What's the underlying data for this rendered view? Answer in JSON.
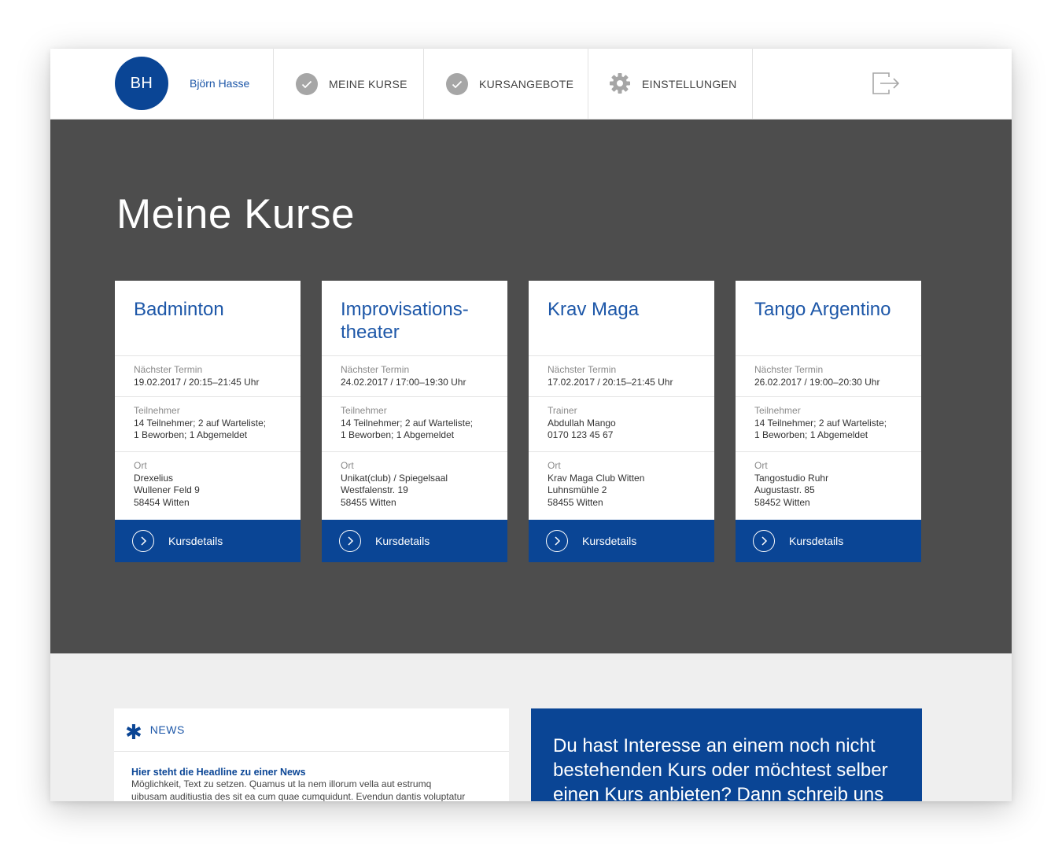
{
  "nav": {
    "user_initials": "BH",
    "user_name": "Björn Hasse",
    "items": [
      {
        "label": "MEINE KURSE",
        "icon": "check-circle-icon"
      },
      {
        "label": "KURSANGEBOTE",
        "icon": "check-circle-icon"
      },
      {
        "label": "EINSTELLUNGEN",
        "icon": "gear-icon"
      }
    ],
    "logout_icon": "logout-icon"
  },
  "hero": {
    "title": "Meine Kurse"
  },
  "cards": [
    {
      "title_line1": "Badminton",
      "title_line2": "",
      "s1_label": "Nächster Termin",
      "s1_lines": [
        "19.02.2017 / 20:15–21:45 Uhr"
      ],
      "s2_label": "Teilnehmer",
      "s2_lines": [
        "14 Teilnehmer; 2 auf Warteliste;",
        "1 Beworben; 1 Abgemeldet"
      ],
      "s3_label": "Ort",
      "s3_lines": [
        "Drexelius",
        "Wullener Feld 9",
        "58454 Witten"
      ],
      "button": "Kursdetails"
    },
    {
      "title_line1": "Improvisations-",
      "title_line2": "theater",
      "s1_label": "Nächster Termin",
      "s1_lines": [
        "24.02.2017 / 17:00–19:30 Uhr"
      ],
      "s2_label": "Teilnehmer",
      "s2_lines": [
        "14 Teilnehmer; 2 auf Warteliste;",
        "1 Beworben; 1 Abgemeldet"
      ],
      "s3_label": "Ort",
      "s3_lines": [
        "Unikat(club) / Spiegelsaal",
        "Westfalenstr. 19",
        "58455 Witten"
      ],
      "button": "Kursdetails"
    },
    {
      "title_line1": "Krav Maga",
      "title_line2": "",
      "s1_label": "Nächster Termin",
      "s1_lines": [
        "17.02.2017 / 20:15–21:45 Uhr"
      ],
      "s2_label": "Trainer",
      "s2_lines": [
        "Abdullah Mango",
        "0170 123 45 67"
      ],
      "s3_label": "Ort",
      "s3_lines": [
        "Krav Maga Club Witten",
        "Luhnsmühle 2",
        "58455 Witten"
      ],
      "button": "Kursdetails"
    },
    {
      "title_line1": "Tango Argentino",
      "title_line2": "",
      "s1_label": "Nächster Termin",
      "s1_lines": [
        "26.02.2017 / 19:00–20:30 Uhr"
      ],
      "s2_label": "Teilnehmer",
      "s2_lines": [
        "14 Teilnehmer; 2 auf Warteliste;",
        "1 Beworben; 1 Abgemeldet"
      ],
      "s3_label": "Ort",
      "s3_lines": [
        "Tangostudio Ruhr",
        "Augustastr. 85",
        "58452 Witten"
      ],
      "button": "Kursdetails"
    }
  ],
  "news": {
    "label": "NEWS",
    "headline": "Hier steht die Headline zu einer News",
    "text_line1": "Möglichkeit, Text zu setzen. Quamus ut la nem illorum vella aut estrumq",
    "text_line2": "uibusam auditiustia des sit ea cum quae cumquidunt. Evendun dantis voluptatur"
  },
  "contact": {
    "line1": "Du hast Interesse an einem noch nicht",
    "line2": "bestehenden Kurs oder möchtest selber",
    "line3": "einen Kurs anbieten? Dann schreib uns"
  },
  "colors": {
    "brand_blue": "#0a4595",
    "hero_gray": "#4d4d4d",
    "page_bg": "#efefef",
    "link_blue": "#1d57a8"
  }
}
